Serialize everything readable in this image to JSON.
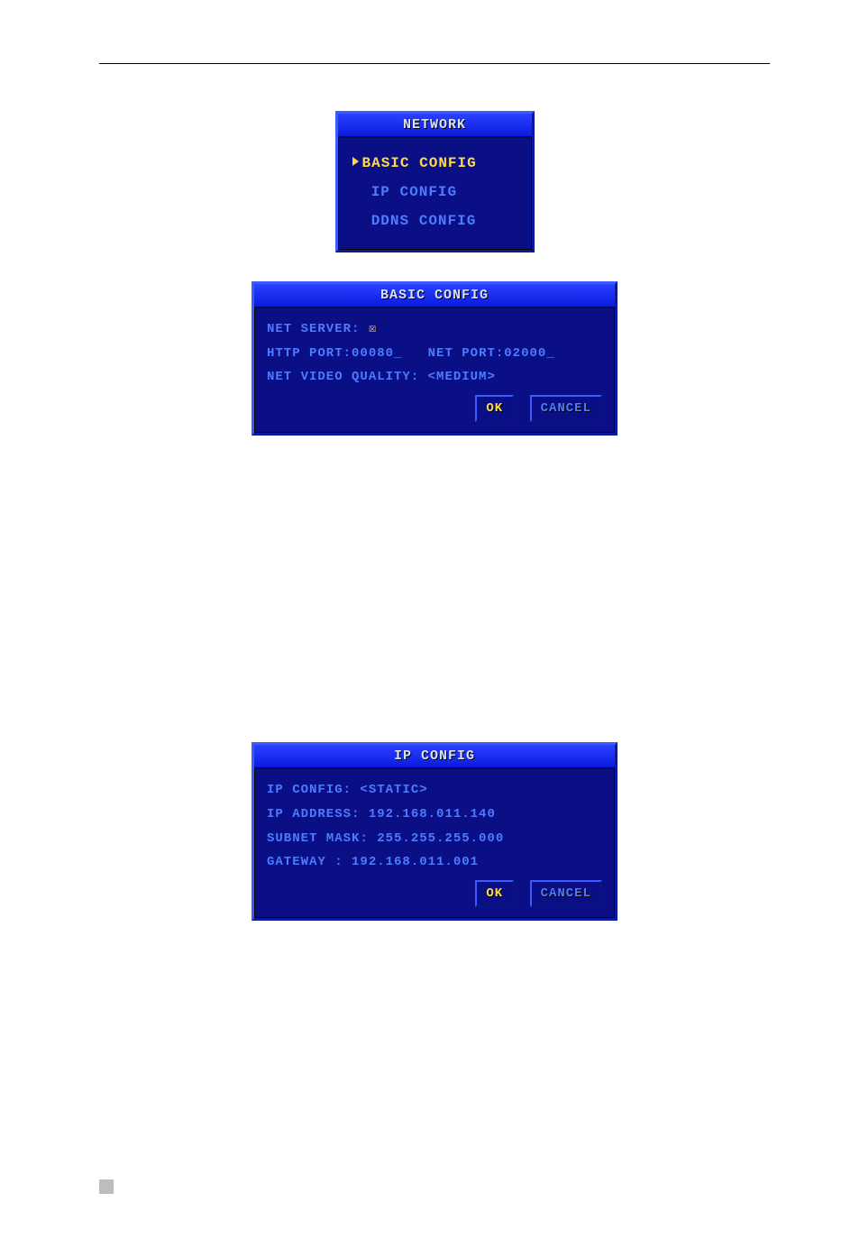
{
  "network_menu": {
    "title": "NETWORK",
    "items": [
      "BASIC  CONFIG",
      "IP    CONFIG",
      "DDNS  CONFIG"
    ]
  },
  "basic_config": {
    "title": "BASIC  CONFIG",
    "net_server_label": "NET  SERVER: ",
    "net_server_value": "☒",
    "http_port_label": "HTTP PORT:",
    "http_port_value": "00080",
    "net_port_label": "NET PORT:",
    "net_port_value": "02000",
    "video_quality_label": "NET  VIDEO  QUALITY: ",
    "video_quality_value": "<MEDIUM>",
    "ok": "OK",
    "cancel": "CANCEL"
  },
  "ip_config": {
    "title": "IP    CONFIG",
    "mode_label": "IP   CONFIG: ",
    "mode_value": "<STATIC>",
    "ip_label": "IP  ADDRESS: ",
    "ip_value": "192.168.011.140",
    "subnet_label": "SUBNET MASK: ",
    "subnet_value": "255.255.255.000",
    "gateway_label": "GATEWAY    : ",
    "gateway_value": "192.168.011.001",
    "ok": "OK",
    "cancel": "CANCEL"
  }
}
